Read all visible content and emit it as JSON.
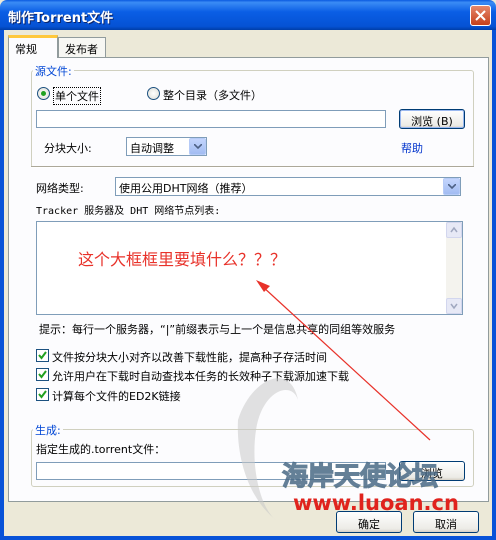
{
  "window": {
    "title": "制作Torrent文件"
  },
  "tabs": [
    {
      "label": "常规"
    },
    {
      "label": "发布者"
    }
  ],
  "source": {
    "legend": "源文件:",
    "single_file_label": "单个文件",
    "directory_label": "整个目录（多文件）",
    "path_value": "",
    "browse_label": "浏览 (B)",
    "piece_size_label": "分块大小:",
    "piece_size_value": "自动调整",
    "help_label": "帮助"
  },
  "network": {
    "type_label": "网络类型:",
    "type_value": "使用公用DHT网络（推荐）",
    "tracker_label": "Tracker 服务器及 DHT 网络节点列表:",
    "tracker_value": "",
    "hint": "提示：每行一个服务器，“|”前缀表示与上一个是信息共享的同组等效服务"
  },
  "options": [
    {
      "label": "文件按分块大小对齐以改善下载性能，提高种子存活时间",
      "checked": true
    },
    {
      "label": "允许用户在下载时自动查找本任务的长效种子下载源加速下载",
      "checked": true
    },
    {
      "label": "计算每个文件的ED2K链接",
      "checked": true
    }
  ],
  "output": {
    "legend": "生成:",
    "path_label": "指定生成的.torrent文件：",
    "path_value": "",
    "browse_label": "浏览"
  },
  "footer": {
    "ok_label": "确定",
    "cancel_label": "取消"
  },
  "annotation": {
    "text": "这个大框框里要填什么？？？",
    "color": "#e8322a"
  },
  "watermark": {
    "name": "海岸天使论坛",
    "url": "www.luoan.cn"
  }
}
